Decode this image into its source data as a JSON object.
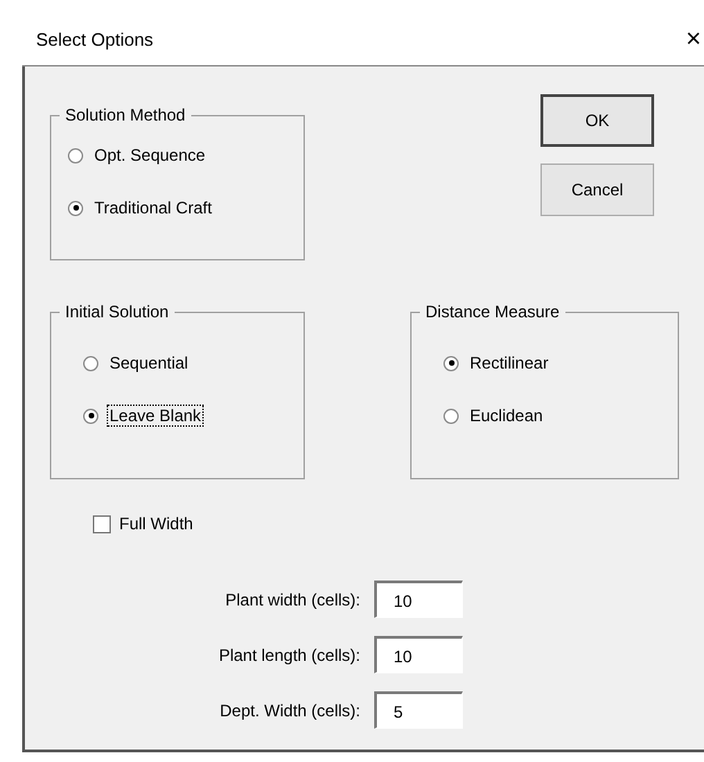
{
  "window": {
    "title": "Select Options",
    "close": "×"
  },
  "solution_method": {
    "title": "Solution Method",
    "options": [
      {
        "label": "Opt. Sequence",
        "selected": false,
        "focused": false
      },
      {
        "label": "Traditional Craft",
        "selected": true,
        "focused": false
      }
    ]
  },
  "buttons": [
    {
      "label": "OK",
      "default": true
    },
    {
      "label": "Cancel",
      "default": false
    }
  ],
  "initial_solution": {
    "title": "Initial Solution",
    "options": [
      {
        "label": "Sequential",
        "selected": false,
        "focused": false
      },
      {
        "label": "Leave Blank",
        "selected": true,
        "focused": true
      }
    ]
  },
  "distance_measure": {
    "title": "Distance Measure",
    "options": [
      {
        "label": "Rectilinear",
        "selected": true,
        "focused": false
      },
      {
        "label": "Euclidean",
        "selected": false,
        "focused": false
      }
    ]
  },
  "full_width": {
    "label": "Full Width",
    "checked": false
  },
  "fields": [
    {
      "label": "Plant width (cells):",
      "value": "10"
    },
    {
      "label": "Plant length (cells):",
      "value": "10"
    },
    {
      "label": "Dept. Width (cells):",
      "value": "5"
    }
  ]
}
